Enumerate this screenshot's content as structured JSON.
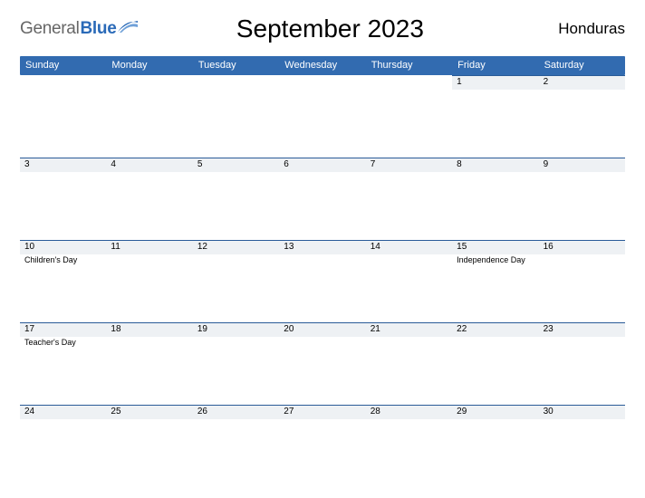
{
  "logo": {
    "general": "General",
    "blue": "Blue"
  },
  "title": "September 2023",
  "region": "Honduras",
  "weekdays": [
    "Sunday",
    "Monday",
    "Tuesday",
    "Wednesday",
    "Thursday",
    "Friday",
    "Saturday"
  ],
  "weeks": [
    [
      {
        "day": "",
        "event": ""
      },
      {
        "day": "",
        "event": ""
      },
      {
        "day": "",
        "event": ""
      },
      {
        "day": "",
        "event": ""
      },
      {
        "day": "",
        "event": ""
      },
      {
        "day": "1",
        "event": ""
      },
      {
        "day": "2",
        "event": ""
      }
    ],
    [
      {
        "day": "3",
        "event": ""
      },
      {
        "day": "4",
        "event": ""
      },
      {
        "day": "5",
        "event": ""
      },
      {
        "day": "6",
        "event": ""
      },
      {
        "day": "7",
        "event": ""
      },
      {
        "day": "8",
        "event": ""
      },
      {
        "day": "9",
        "event": ""
      }
    ],
    [
      {
        "day": "10",
        "event": "Children's Day"
      },
      {
        "day": "11",
        "event": ""
      },
      {
        "day": "12",
        "event": ""
      },
      {
        "day": "13",
        "event": ""
      },
      {
        "day": "14",
        "event": ""
      },
      {
        "day": "15",
        "event": "Independence Day"
      },
      {
        "day": "16",
        "event": ""
      }
    ],
    [
      {
        "day": "17",
        "event": "Teacher's Day"
      },
      {
        "day": "18",
        "event": ""
      },
      {
        "day": "19",
        "event": ""
      },
      {
        "day": "20",
        "event": ""
      },
      {
        "day": "21",
        "event": ""
      },
      {
        "day": "22",
        "event": ""
      },
      {
        "day": "23",
        "event": ""
      }
    ],
    [
      {
        "day": "24",
        "event": ""
      },
      {
        "day": "25",
        "event": ""
      },
      {
        "day": "26",
        "event": ""
      },
      {
        "day": "27",
        "event": ""
      },
      {
        "day": "28",
        "event": ""
      },
      {
        "day": "29",
        "event": ""
      },
      {
        "day": "30",
        "event": ""
      }
    ]
  ]
}
